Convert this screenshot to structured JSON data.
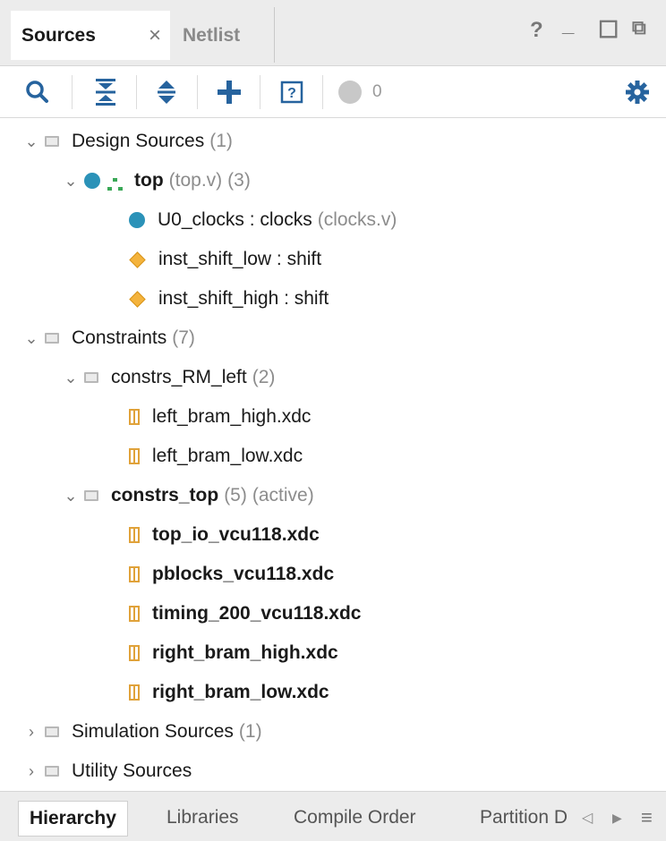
{
  "tabs": {
    "sources": "Sources",
    "close": "×",
    "netlist": "Netlist"
  },
  "window_buttons": {
    "help": "?",
    "minimize": "_",
    "maximize": "☐",
    "float": "⧉"
  },
  "toolbar": {
    "search_icon": "search-icon",
    "collapse_all_icon": "collapse-all-icon",
    "expand_all_icon": "expand-all-icon",
    "add_icon": "plus-icon",
    "help_icon": "question-box-icon",
    "status_count": "0",
    "settings_icon": "gear-icon"
  },
  "tree": {
    "design_sources": {
      "label": "Design Sources",
      "count": "(1)"
    },
    "top": {
      "label": "top",
      "file": "(top.v)",
      "count": "(3)"
    },
    "u0_clocks": {
      "label": "U0_clocks : clocks",
      "file": "(clocks.v)"
    },
    "inst_shift_low": {
      "label": "inst_shift_low : shift"
    },
    "inst_shift_high": {
      "label": "inst_shift_high : shift"
    },
    "constraints": {
      "label": "Constraints",
      "count": "(7)"
    },
    "constrs_rm_left": {
      "label": "constrs_RM_left",
      "count": "(2)"
    },
    "left_bram_high": {
      "label": "left_bram_high.xdc"
    },
    "left_bram_low": {
      "label": "left_bram_low.xdc"
    },
    "constrs_top": {
      "label": "constrs_top",
      "count": "(5)",
      "status": "(active)"
    },
    "top_io": {
      "label": "top_io_vcu118.xdc"
    },
    "pblocks": {
      "label": "pblocks_vcu118.xdc"
    },
    "timing": {
      "label": "timing_200_vcu118.xdc"
    },
    "right_bram_high": {
      "label": "right_bram_high.xdc"
    },
    "right_bram_low": {
      "label": "right_bram_low.xdc"
    },
    "simulation_sources": {
      "label": "Simulation Sources",
      "count": "(1)"
    },
    "utility_sources": {
      "label": "Utility Sources"
    }
  },
  "bottom_tabs": {
    "hierarchy": "Hierarchy",
    "libraries": "Libraries",
    "compile_order": "Compile Order",
    "partition": "Partition D",
    "scroll_left": "◁",
    "scroll_right": "▶",
    "menu": "≡"
  },
  "colors": {
    "accent": "#26639e",
    "module_dot": "#2b92b8",
    "instance_diamond": "#f4b33c",
    "xdc_file": "#e0a23a"
  }
}
